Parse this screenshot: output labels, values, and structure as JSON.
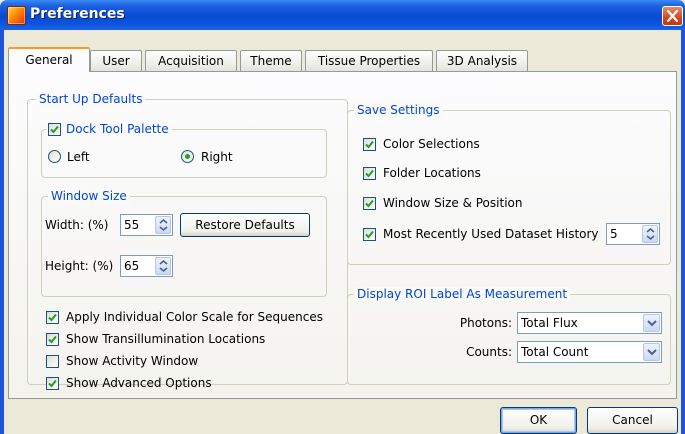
{
  "window": {
    "title": "Preferences"
  },
  "tabs": [
    {
      "label": "General",
      "active": true
    },
    {
      "label": "User"
    },
    {
      "label": "Acquisition"
    },
    {
      "label": "Theme"
    },
    {
      "label": "Tissue Properties"
    },
    {
      "label": "3D Analysis"
    }
  ],
  "startup": {
    "legend": "Start Up Defaults",
    "dock": {
      "label": "Dock Tool Palette",
      "checked": true,
      "left_label": "Left",
      "right_label": "Right",
      "selected": "Right"
    },
    "window_size": {
      "legend": "Window Size",
      "width_label": "Width: (%)",
      "width_value": "55",
      "height_label": "Height: (%)",
      "height_value": "65",
      "restore_label": "Restore Defaults"
    },
    "options": [
      {
        "label": "Apply Individual Color Scale for Sequences",
        "checked": true
      },
      {
        "label": "Show Transillumination Locations",
        "checked": true
      },
      {
        "label": "Show Activity Window",
        "checked": false
      },
      {
        "label": "Show Advanced Options",
        "checked": true
      }
    ]
  },
  "save": {
    "legend": "Save Settings",
    "items": [
      {
        "label": "Color Selections",
        "checked": true
      },
      {
        "label": "Folder Locations",
        "checked": true
      },
      {
        "label": "Window Size & Position",
        "checked": true
      },
      {
        "label": "Most Recently Used Dataset History",
        "checked": true
      }
    ],
    "history_value": "5"
  },
  "roi": {
    "legend": "Display ROI Label As Measurement",
    "photons_label": "Photons:",
    "photons_value": "Total Flux",
    "counts_label": "Counts:",
    "counts_value": "Total Count"
  },
  "footer": {
    "ok_label": "OK",
    "cancel_label": "Cancel"
  },
  "colors": {
    "title_bar": "#0a49d5",
    "accent_tab": "#ff9a1f",
    "legend_text": "#0046d5",
    "check": "#21a121"
  }
}
